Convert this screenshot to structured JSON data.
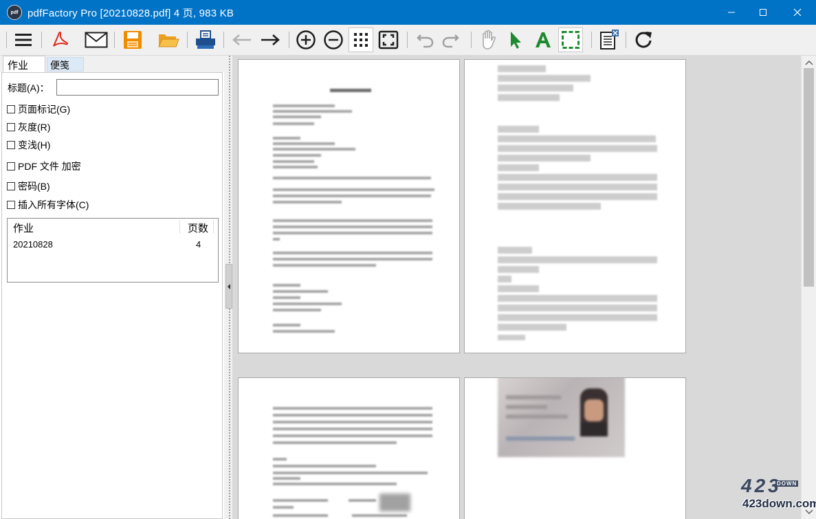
{
  "window": {
    "app_icon_text": "pdf",
    "title": "pdfFactory Pro [20210828.pdf] 4 页, 983 KB",
    "controls": [
      "minimize-icon",
      "maximize-icon",
      "close-icon"
    ]
  },
  "toolbar": {
    "buttons": [
      {
        "name": "menu-icon"
      },
      {
        "name": "pdf-icon",
        "color": "#e02a1d"
      },
      {
        "name": "mail-icon"
      },
      {
        "name": "save-icon",
        "color": "#f08c00"
      },
      {
        "name": "open-folder-icon",
        "color": "#f0a020"
      },
      {
        "name": "print-icon",
        "color": "#1f4e8c"
      },
      {
        "name": "back-arrow-icon",
        "enabled": false
      },
      {
        "name": "forward-arrow-icon"
      },
      {
        "name": "zoom-in-icon"
      },
      {
        "name": "zoom-out-icon"
      },
      {
        "name": "grid-view-icon",
        "active": true
      },
      {
        "name": "fit-page-icon"
      },
      {
        "name": "undo-icon",
        "enabled": false
      },
      {
        "name": "redo-icon",
        "enabled": false
      },
      {
        "name": "hand-tool-icon",
        "enabled": false
      },
      {
        "name": "select-arrow-icon",
        "color": "#1e8a2e"
      },
      {
        "name": "text-tool-icon",
        "color": "#1e8a2e"
      },
      {
        "name": "area-select-icon",
        "color": "#1e8a2e",
        "active": true
      },
      {
        "name": "document-close-icon"
      },
      {
        "name": "refresh-icon"
      }
    ]
  },
  "left_panel": {
    "tabs": [
      {
        "label": "作业",
        "active": true
      },
      {
        "label": "便笺",
        "active": false
      }
    ],
    "title_field": {
      "label": "标题(A)：",
      "value": ""
    },
    "checkboxes": [
      {
        "label": "页面标记(G)",
        "checked": false
      },
      {
        "label": "灰度(R)",
        "checked": false
      },
      {
        "label": "变浅(H)",
        "checked": false
      },
      {
        "label": "PDF 文件 加密",
        "checked": false
      },
      {
        "label": "密码(B)",
        "checked": false
      },
      {
        "label": "插入所有字体(C)",
        "checked": false
      }
    ],
    "jobs_table": {
      "headers": [
        "作业",
        "页数"
      ],
      "rows": [
        {
          "name": "20210828",
          "pages": "4"
        }
      ]
    }
  },
  "preview": {
    "page_count": 4,
    "page1": {
      "partial_text": "日"
    }
  },
  "watermark": {
    "logo": "423",
    "sub": "DOWN",
    "url": "423down.com"
  }
}
